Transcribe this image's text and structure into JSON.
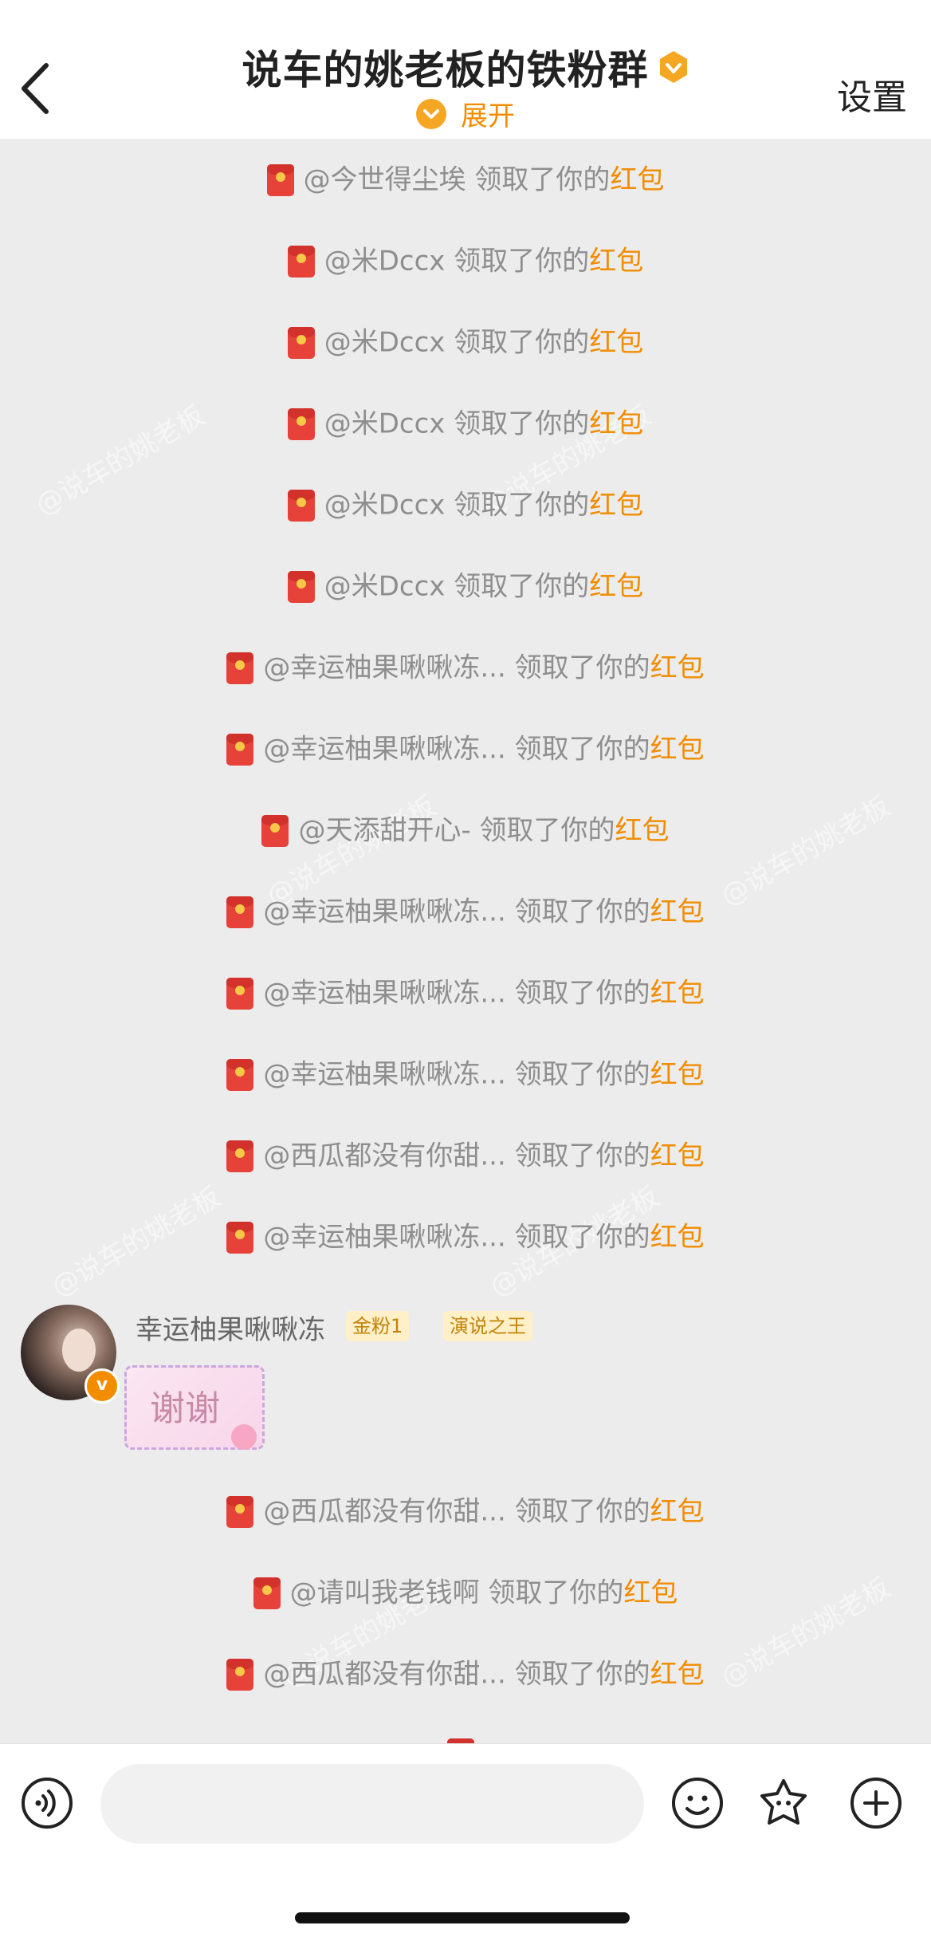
{
  "header": {
    "title": "说车的姚老板的铁粉群",
    "expand_label": "展开",
    "settings_label": "设置"
  },
  "messages": [
    {
      "user": "@今世得尘埃",
      "action": " 领取了你的",
      "link": "红包"
    },
    {
      "user": "@米Dccx",
      "action": " 领取了你的",
      "link": "红包"
    },
    {
      "user": "@米Dccx",
      "action": " 领取了你的",
      "link": "红包"
    },
    {
      "user": "@米Dccx",
      "action": " 领取了你的",
      "link": "红包"
    },
    {
      "user": "@米Dccx",
      "action": " 领取了你的",
      "link": "红包"
    },
    {
      "user": "@米Dccx",
      "action": " 领取了你的",
      "link": "红包"
    },
    {
      "user": "@幸运柚果啾啾冻...",
      "action": " 领取了你的",
      "link": "红包"
    },
    {
      "user": "@幸运柚果啾啾冻...",
      "action": " 领取了你的",
      "link": "红包"
    },
    {
      "user": "@天添甜开心-",
      "action": " 领取了你的",
      "link": "红包"
    },
    {
      "user": "@幸运柚果啾啾冻...",
      "action": " 领取了你的",
      "link": "红包"
    },
    {
      "user": "@幸运柚果啾啾冻...",
      "action": " 领取了你的",
      "link": "红包"
    },
    {
      "user": "@幸运柚果啾啾冻...",
      "action": " 领取了你的",
      "link": "红包"
    },
    {
      "user": "@西瓜都没有你甜...",
      "action": " 领取了你的",
      "link": "红包"
    },
    {
      "user": "@幸运柚果啾啾冻...",
      "action": " 领取了你的",
      "link": "红包"
    }
  ],
  "chat": {
    "username": "幸运柚果啾啾冻",
    "tag1": "金粉1",
    "tag2": "演说之王",
    "sticker_text": "谢谢"
  },
  "messages2": [
    {
      "user": "@西瓜都没有你甜...",
      "action": " 领取了你的",
      "link": "红包"
    },
    {
      "user": "@请叫我老钱啊",
      "action": " 领取了你的",
      "link": "红包"
    },
    {
      "user": "@西瓜都没有你甜...",
      "action": " 领取了你的",
      "link": "红包"
    }
  ],
  "watermark": "@说车的姚老板",
  "colors": {
    "accent": "#f28c00",
    "background": "#ececec"
  }
}
